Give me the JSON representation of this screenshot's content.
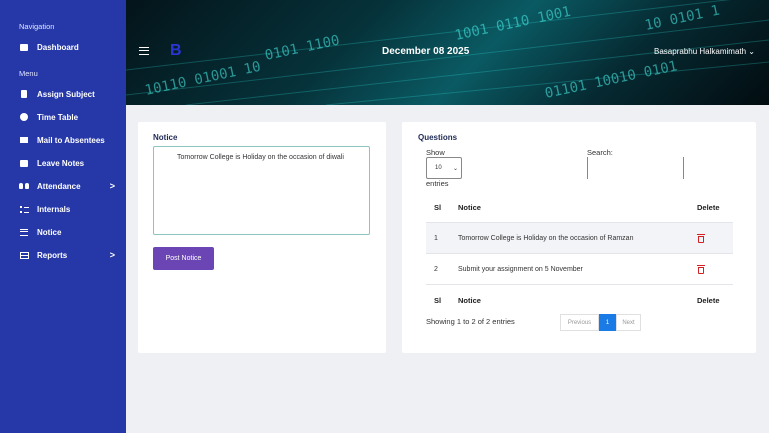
{
  "sidebar": {
    "nav_heading": "Navigation",
    "menu_heading": "Menu",
    "items": [
      {
        "label": "Dashboard",
        "icon": "dashboard-icon"
      },
      {
        "label": "Assign Subject",
        "icon": "book-icon"
      },
      {
        "label": "Time Table",
        "icon": "clock-icon"
      },
      {
        "label": "Mail to Absentees",
        "icon": "mail-icon"
      },
      {
        "label": "Leave Notes",
        "icon": "note-icon"
      },
      {
        "label": "Attendance",
        "icon": "users-icon",
        "chevron": ">"
      },
      {
        "label": "Internals",
        "icon": "list-icon"
      },
      {
        "label": "Notice",
        "icon": "menu-lines-icon"
      },
      {
        "label": "Reports",
        "icon": "table-icon",
        "chevron": ">"
      }
    ]
  },
  "header": {
    "logo": "B",
    "date": "December 08 2025",
    "user": "Basaprabhu Halkamimath",
    "user_caret": "⌄"
  },
  "notice_panel": {
    "title": "Notice",
    "text": "Tomorrow College is Holiday on the occasion of diwali",
    "post_button": "Post Notice"
  },
  "questions_panel": {
    "title": "Questions",
    "show_label": "Show",
    "page_size": "10",
    "entries_label": "entries",
    "search_label": "Search:",
    "columns": [
      "Sl",
      "Notice",
      "Delete"
    ],
    "rows": [
      {
        "sl": "1",
        "notice": "Tomorrow College is Holiday on the occasion of Ramzan"
      },
      {
        "sl": "2",
        "notice": "Submit your assignment on 5 November"
      }
    ],
    "footer_columns": [
      "Sl",
      "Notice",
      "Delete"
    ],
    "info": "Showing 1 to 2 of 2 entries",
    "pagination": {
      "previous": "Previous",
      "current": "1",
      "next": "Next"
    }
  },
  "colors": {
    "sidebar": "#2638a8",
    "post_button": "#6a45b3",
    "pager_active": "#1a7ae6",
    "delete_icon": "#d42020"
  }
}
